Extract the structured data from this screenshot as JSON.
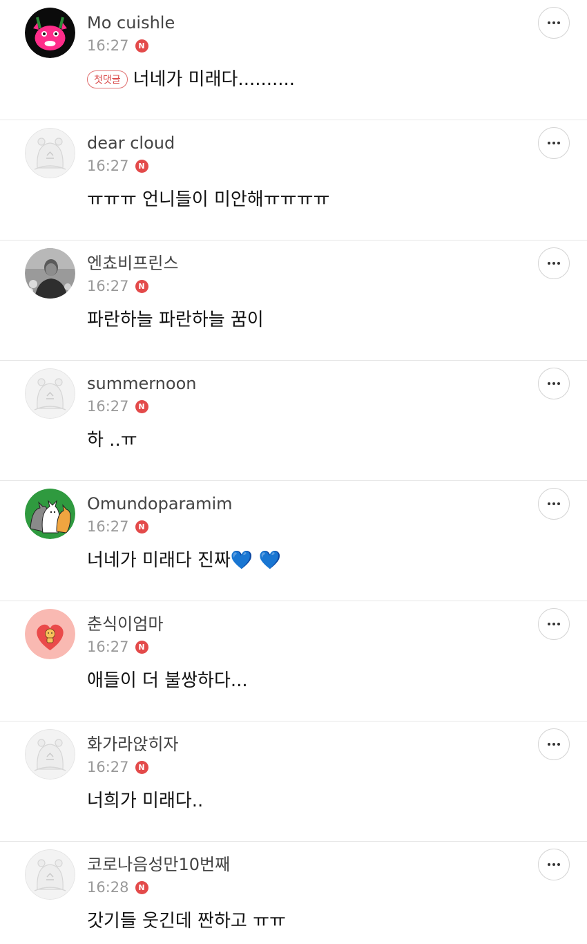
{
  "comments": [
    {
      "author": "Mo cuishle",
      "time": "16:27",
      "badge": "N",
      "tag": "첫댓글",
      "text": "너네가 미래다..........",
      "avatar": "pink-monster-avatar"
    },
    {
      "author": "dear cloud",
      "time": "16:27",
      "badge": "N",
      "tag": "",
      "text": "ㅠㅠㅠ 언니들이 미안해ㅠㅠㅠㅠ",
      "avatar": "default-avatar"
    },
    {
      "author": "엔쵸비프린스",
      "time": "16:27",
      "badge": "N",
      "tag": "",
      "text": "파란하늘 파란하늘 꿈이",
      "avatar": "photo-avatar"
    },
    {
      "author": "summernoon",
      "time": "16:27",
      "badge": "N",
      "tag": "",
      "text": "하 ..ㅠ",
      "avatar": "default-avatar"
    },
    {
      "author": "Omundoparamim",
      "time": "16:27",
      "badge": "N",
      "tag": "",
      "text": "너네가 미래다 진짜💙 💙",
      "avatar": "cats-avatar"
    },
    {
      "author": "춘식이엄마",
      "time": "16:27",
      "badge": "N",
      "tag": "",
      "text": "애들이 더 불쌍하다...",
      "avatar": "heart-avatar"
    },
    {
      "author": "화가라앉히자",
      "time": "16:27",
      "badge": "N",
      "tag": "",
      "text": "너희가 미래다..",
      "avatar": "default-avatar"
    },
    {
      "author": "코로나음성만10번째",
      "time": "16:28",
      "badge": "N",
      "tag": "",
      "text": "갓기들 웃긴데 짠하고 ㅠㅠ",
      "avatar": "default-avatar"
    }
  ],
  "colors": {
    "badge": "#e34a4a",
    "tag_border": "#e07070",
    "divider": "#e6e6e6",
    "author": "#444444",
    "time": "#999999"
  },
  "icons": {
    "more": "more-horizontal-icon",
    "new": "new-badge-icon"
  }
}
